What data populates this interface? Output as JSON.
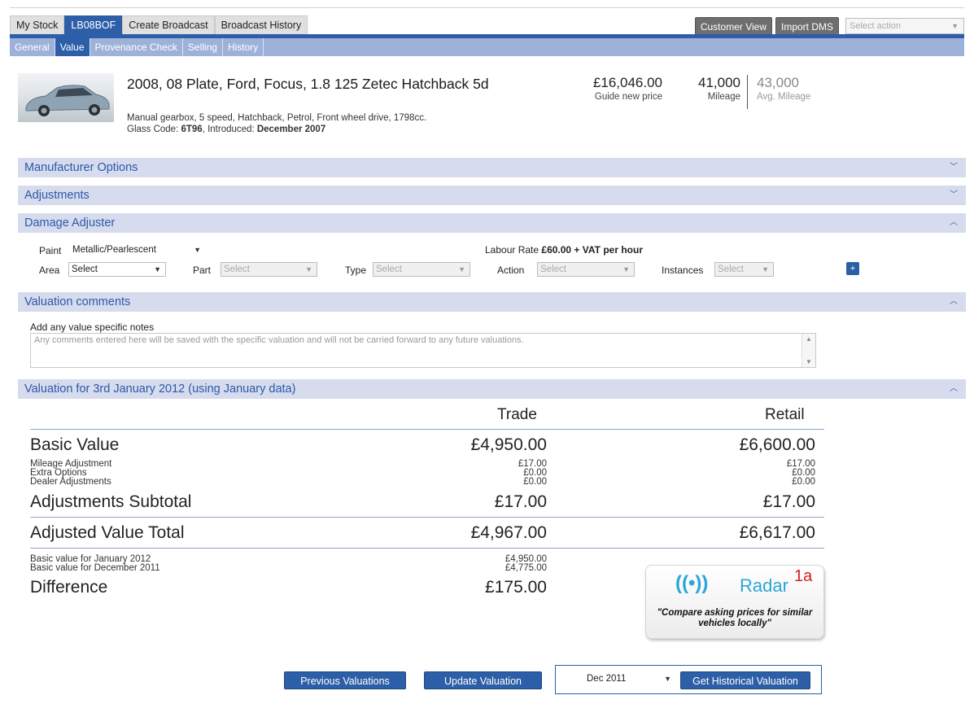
{
  "top_tabs": [
    "My Stock",
    "LB08BOF",
    "Create Broadcast",
    "Broadcast History"
  ],
  "top_buttons": {
    "customer_view": "Customer View",
    "import_dms": "Import DMS",
    "select_action": "Select action"
  },
  "sub_tabs": [
    "General",
    "Value",
    "Provenance Check",
    "Selling",
    "History"
  ],
  "vehicle": {
    "title": "2008, 08 Plate, Ford, Focus, 1.8 125 Zetec Hatchback 5d",
    "spec": "Manual gearbox, 5 speed, Hatchback, Petrol, Front wheel drive, 1798cc.",
    "glass_prefix": "Glass Code: ",
    "glass_code": "6T96",
    "introduced_prefix": ", Introduced: ",
    "introduced": "December 2007",
    "guide_price": "£16,046.00",
    "guide_price_label": "Guide new price",
    "mileage": "41,000",
    "mileage_label": "Mileage",
    "avg_mileage": "43,000",
    "avg_mileage_label": "Avg. Mileage"
  },
  "sections": {
    "manufacturer_options": "Manufacturer Options",
    "adjustments": "Adjustments",
    "damage_adjuster": "Damage Adjuster",
    "valuation_comments": "Valuation comments",
    "valuation": "Valuation for 3rd January 2012 (using January data)"
  },
  "damage": {
    "paint_label": "Paint",
    "paint_value": "Metallic/Pearlescent",
    "labour_prefix": "Labour Rate ",
    "labour_value": "£60.00 + VAT per hour",
    "area_label": "Area",
    "area_value": "Select",
    "part_label": "Part",
    "part_value": "Select",
    "type_label": "Type",
    "type_value": "Select",
    "action_label": "Action",
    "action_value": "Select",
    "instances_label": "Instances",
    "instances_value": "Select",
    "add": "+"
  },
  "comments": {
    "label": "Add any value specific notes",
    "placeholder": "Any comments entered here will be saved with the specific valuation and will not be carried forward to any future valuations."
  },
  "valuation": {
    "trade_header": "Trade",
    "retail_header": "Retail",
    "basic_label": "Basic Value",
    "basic_trade": "£4,950.00",
    "basic_retail": "£6,600.00",
    "adj_rows": [
      {
        "label": "Mileage Adjustment",
        "trade": "£17.00",
        "retail": "£17.00"
      },
      {
        "label": "Extra Options",
        "trade": "£0.00",
        "retail": "£0.00"
      },
      {
        "label": "Dealer Adjustments",
        "trade": "£0.00",
        "retail": "£0.00"
      }
    ],
    "subtotal_label": "Adjustments Subtotal",
    "subtotal_trade": "£17.00",
    "subtotal_retail": "£17.00",
    "total_label": "Adjusted Value Total",
    "total_trade": "£4,967.00",
    "total_retail": "£6,617.00",
    "basic_jan_label": "Basic value for January 2012",
    "basic_jan_value": "£4,950.00",
    "basic_dec_label": "Basic value for December 2011",
    "basic_dec_value": "£4,775.00",
    "difference_label": "Difference",
    "difference_value": "£175.00"
  },
  "radar": {
    "icon": "((•))",
    "word": "Radar",
    "sup": "1a",
    "tagline": "\"Compare asking prices for similar vehicles locally\""
  },
  "buttons": {
    "previous": "Previous Valuations",
    "update": "Update Valuation",
    "month": "Dec 2011",
    "historical": "Get Historical Valuation"
  }
}
